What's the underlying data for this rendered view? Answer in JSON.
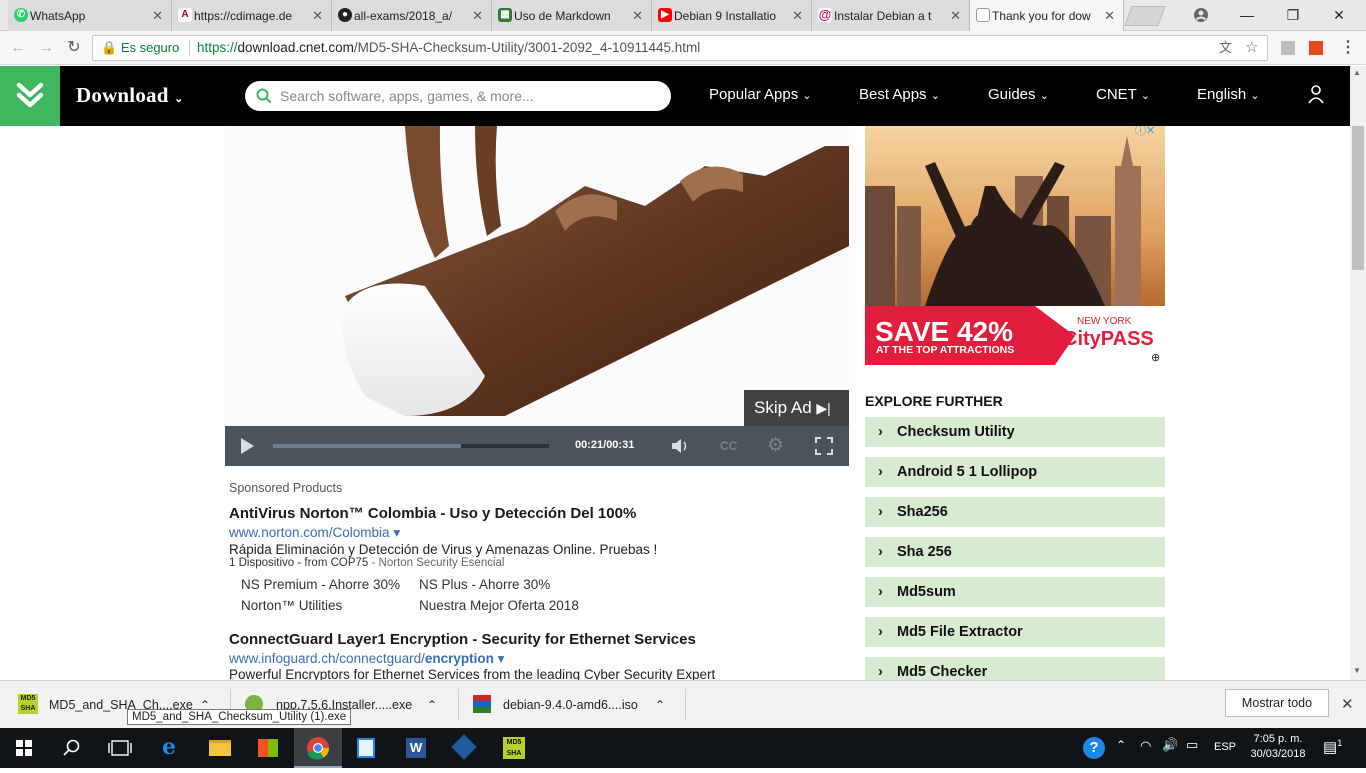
{
  "browser": {
    "tabs": [
      {
        "title": "WhatsApp",
        "icon": "whatsapp-icon",
        "color": "#25d366"
      },
      {
        "title": "https://cdimage.de",
        "icon": "debian-icon",
        "color": "#a80030"
      },
      {
        "title": "all-exams/2018_a/",
        "icon": "github-icon",
        "color": "#222222"
      },
      {
        "title": "Uso de Markdown",
        "icon": "sheets-icon",
        "color": "#2e7d32"
      },
      {
        "title": "Debian 9 Installatio",
        "icon": "youtube-icon",
        "color": "#ff0000"
      },
      {
        "title": "Instalar Debian a t",
        "icon": "debian-swirl-icon",
        "color": "#d70751"
      },
      {
        "title": "Thank you for dow",
        "icon": "page-icon",
        "color": "#777777"
      }
    ],
    "address": {
      "secure_label": "Es seguro",
      "url_scheme": "https://",
      "url_host": "download.cnet.com",
      "url_path": "/MD5-SHA-Checksum-Utility/3001-2092_4-10911445.html"
    }
  },
  "site": {
    "brand": "Download",
    "search_placeholder": "Search software, apps, games, & more...",
    "nav": [
      "Popular Apps",
      "Best Apps",
      "Guides",
      "CNET",
      "English"
    ]
  },
  "video": {
    "skip_label": "Skip Ad",
    "time": "00:21/00:31",
    "progress": 0.68
  },
  "side_ad": {
    "headline": "SAVE 42%",
    "subline": "AT THE TOP ATTRACTIONS",
    "brand_top": "NEW YORK",
    "brand_name_a": "City",
    "brand_name_b": "PASS"
  },
  "explore": {
    "title": "EXPLORE FURTHER",
    "items": [
      "Checksum Utility",
      "Android 5 1 Lollipop",
      "Sha256",
      "Sha 256",
      "Md5sum",
      "Md5 File Extractor",
      "Md5 Checker"
    ]
  },
  "sponsored": {
    "label": "Sponsored Products",
    "ads": [
      {
        "title": "AntiVirus Norton™ Colombia - Uso y Detección Del 100%",
        "url": "www.norton.com/Colombia ▾",
        "desc": "Rápida Eliminación y Detección de Virus y Amenazas Online. Pruebas !",
        "meta_a": "1 Dispositivo - from COP75",
        "meta_b": " - Norton Security Esencial",
        "links": [
          "NS Premium - Ahorre 30%",
          "NS Plus - Ahorre 30%",
          "Norton™ Utilities",
          "Nuestra Mejor Oferta 2018"
        ]
      },
      {
        "title": "ConnectGuard Layer1 Encryption - Security for Ethernet Services",
        "url_a": "www.infoguard.ch/connectguard/",
        "url_b": "encryption",
        "url_c": " ▾",
        "desc": "Powerful Encryptors for Ethernet Services from the leading Cyber Security Expert"
      }
    ]
  },
  "downloads": {
    "items": [
      "MD5_and_SHA_Ch....exe",
      "npp.7.5.6.Installer.....exe",
      "debian-9.4.0-amd6....iso"
    ],
    "tooltip": "MD5_and_SHA_Checksum_Utility (1).exe",
    "show_all": "Mostrar todo"
  },
  "taskbar": {
    "lang": "ESP",
    "time": "7:05 p. m.",
    "date": "30/03/2018",
    "notif_count": "1",
    "md5_a": "MD5",
    "md5_b": "SHA"
  }
}
